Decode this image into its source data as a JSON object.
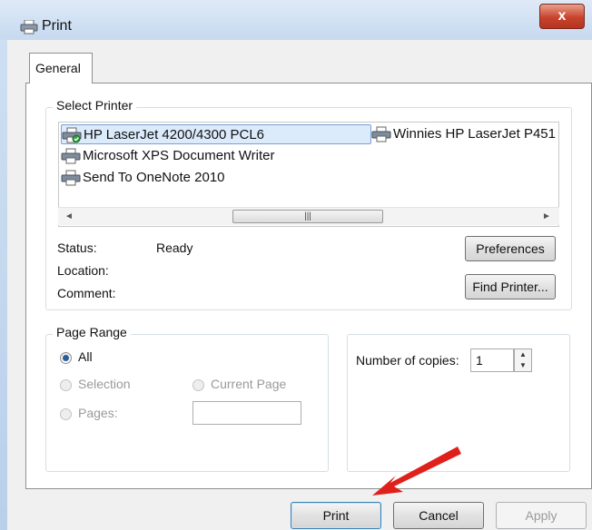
{
  "window": {
    "title": "Print",
    "close_label": "x"
  },
  "tabs": [
    {
      "label": "General"
    }
  ],
  "select_printer": {
    "group_title": "Select Printer",
    "printers": [
      {
        "name": "HP LaserJet 4200/4300 PCL6",
        "selected": true,
        "default": true
      },
      {
        "name": "Winnies HP LaserJet P451",
        "selected": false,
        "default": false
      },
      {
        "name": "Microsoft XPS Document Writer",
        "selected": false,
        "default": false
      },
      {
        "name": "Send To OneNote 2010",
        "selected": false,
        "default": false
      }
    ],
    "status_label": "Status:",
    "status_value": "Ready",
    "location_label": "Location:",
    "comment_label": "Comment:",
    "preferences_button": "Preferences",
    "find_printer_button": "Find Printer..."
  },
  "page_range": {
    "group_title": "Page Range",
    "all_label": "All",
    "selection_label": "Selection",
    "current_page_label": "Current Page",
    "pages_label": "Pages:"
  },
  "copies": {
    "label": "Number of copies:",
    "value": "1"
  },
  "buttons": {
    "print": "Print",
    "cancel": "Cancel",
    "apply": "Apply"
  },
  "annotation": {
    "arrow_color": "#e0201b"
  }
}
